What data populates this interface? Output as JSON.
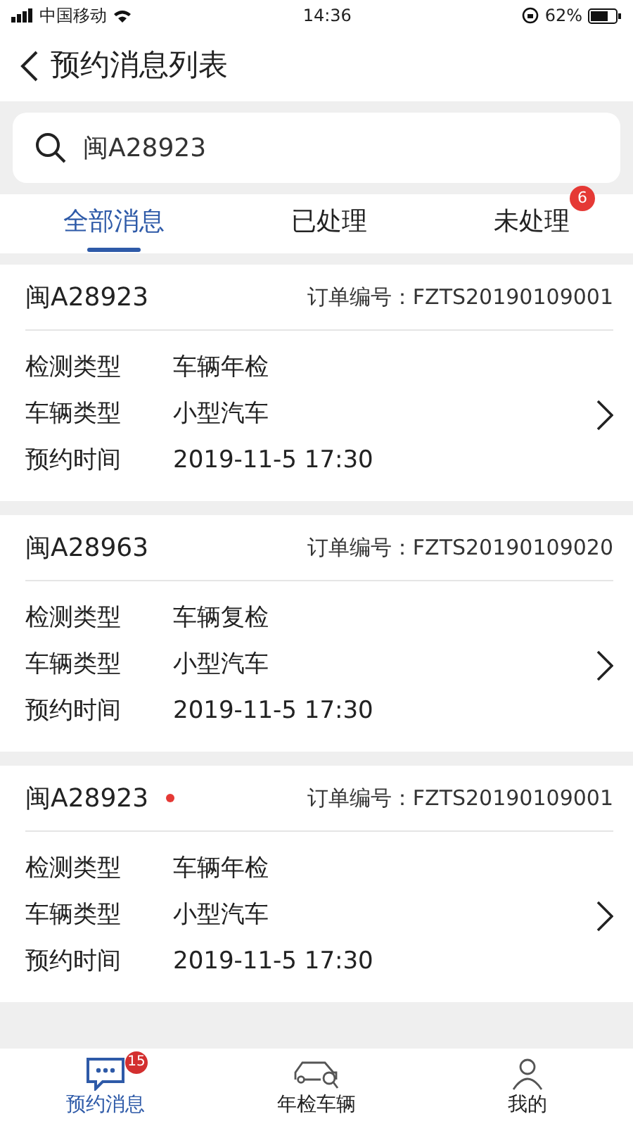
{
  "status_bar": {
    "carrier": "中国移动",
    "time": "14:36",
    "battery": "62%"
  },
  "header": {
    "title": "预约消息列表"
  },
  "search": {
    "value": "闽A28923"
  },
  "tabs": [
    {
      "label": "全部消息",
      "selected": true
    },
    {
      "label": "已处理",
      "selected": false
    },
    {
      "label": "未处理",
      "selected": false,
      "badge": "6"
    }
  ],
  "orders": [
    {
      "plate": "闽A28923",
      "unread": false,
      "order_label": "订单编号：",
      "order_no": "FZTS20190109001",
      "fields": [
        {
          "label": "检测类型",
          "value": "车辆年检"
        },
        {
          "label": "车辆类型",
          "value": "小型汽车"
        },
        {
          "label": "预约时间",
          "value": "2019-11-5  17:30"
        }
      ]
    },
    {
      "plate": "闽A28963",
      "unread": false,
      "order_label": "订单编号：",
      "order_no": "FZTS20190109020",
      "fields": [
        {
          "label": "检测类型",
          "value": "车辆复检"
        },
        {
          "label": "车辆类型",
          "value": "小型汽车"
        },
        {
          "label": "预约时间",
          "value": "2019-11-5  17:30"
        }
      ]
    },
    {
      "plate": "闽A28923",
      "unread": true,
      "order_label": "订单编号：",
      "order_no": "FZTS20190109001",
      "fields": [
        {
          "label": "检测类型",
          "value": "车辆年检"
        },
        {
          "label": "车辆类型",
          "value": "小型汽车"
        },
        {
          "label": "预约时间",
          "value": "2019-11-5  17:30"
        }
      ]
    }
  ],
  "bottom_nav": [
    {
      "label": "预约消息",
      "kind": "messages",
      "selected": true,
      "badge": "15"
    },
    {
      "label": "年检车辆",
      "kind": "car",
      "selected": false
    },
    {
      "label": "我的",
      "kind": "person",
      "selected": false
    }
  ]
}
